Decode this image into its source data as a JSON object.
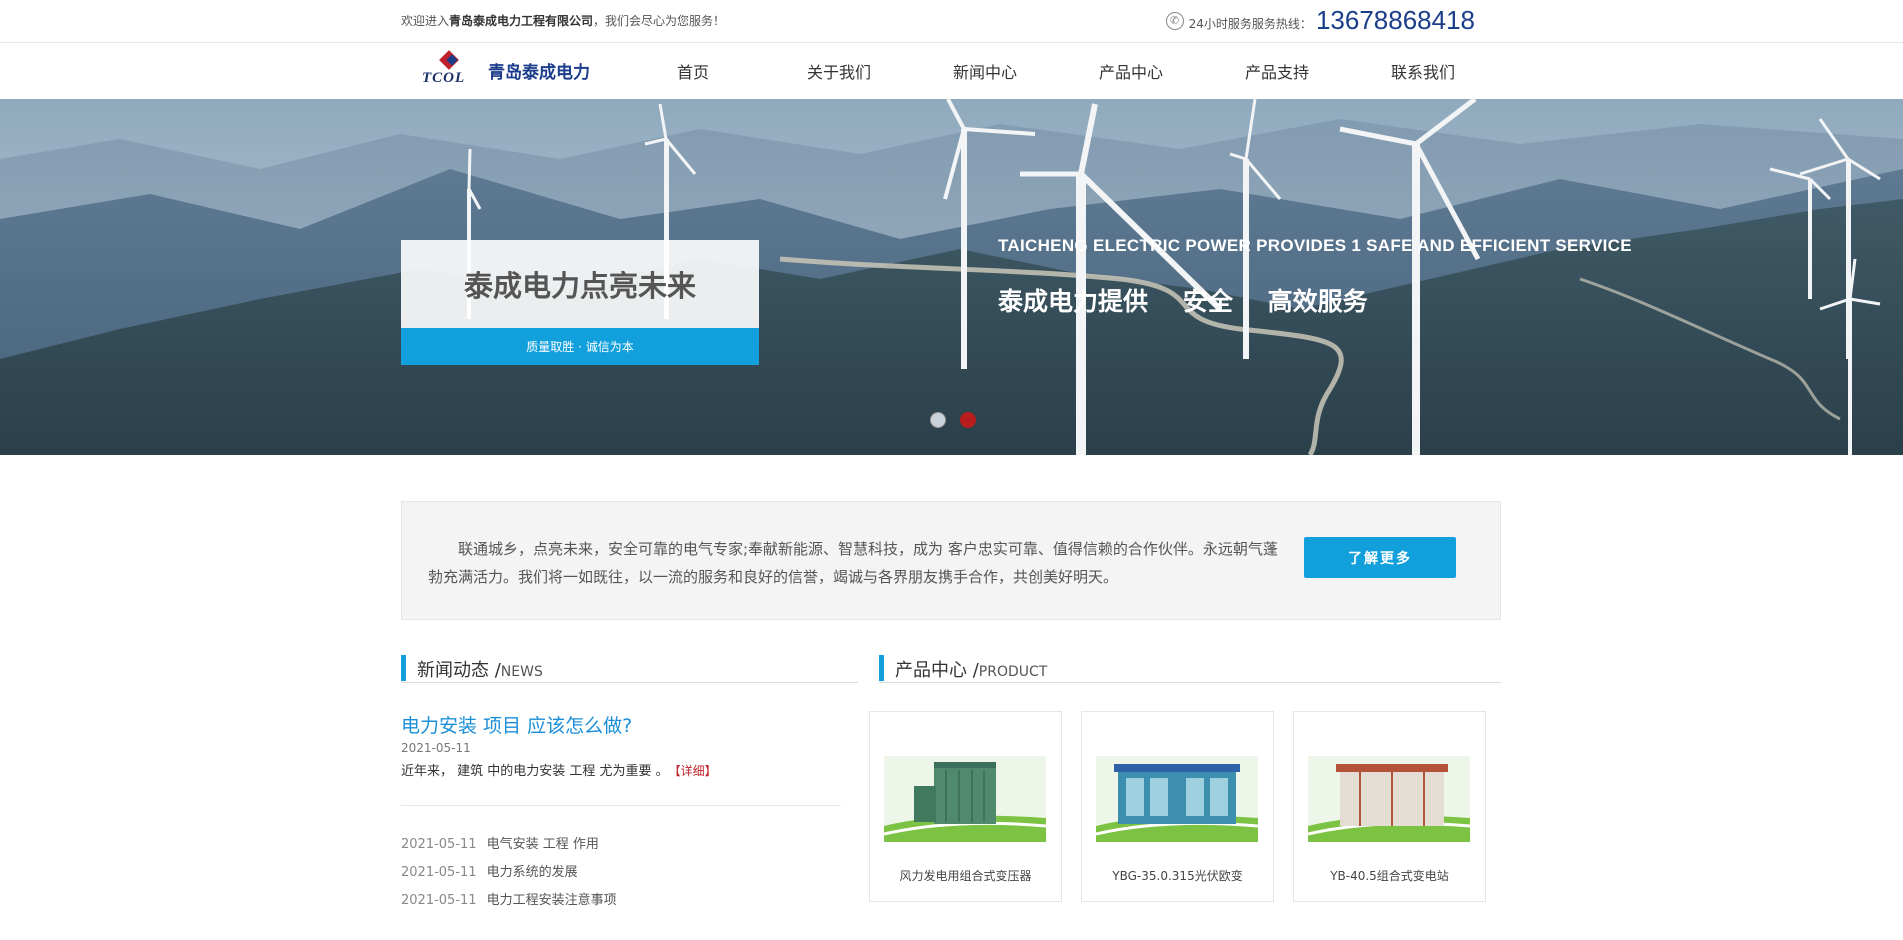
{
  "topbar": {
    "welcome_prefix": "欢迎进入",
    "company": "青岛泰成电力工程有限公司",
    "welcome_suffix": "，我们会尽心为您服务！",
    "hotline_label": "24小时服务服务热线：",
    "hotline_number": "13678868418",
    "phone_icon": "phone-icon"
  },
  "nav": {
    "logo_text": "TCOL",
    "brand": "青岛泰成电力",
    "items": [
      {
        "label": "首页"
      },
      {
        "label": "关于我们"
      },
      {
        "label": "新闻中心"
      },
      {
        "label": "产品中心"
      },
      {
        "label": "产品支持"
      },
      {
        "label": "联系我们"
      }
    ]
  },
  "banner": {
    "slogan": "泰成电力点亮未来",
    "sub_slogan": "质量取胜 · 诚信为本",
    "en_title": "TAICHENG ELECTRIC POWER PROVIDES 1 SAFE AND EFFICIENT SERVICE",
    "cn_title": "泰成电力提供    安全    高效服务",
    "slide_count": 2,
    "active_slide": 2
  },
  "intro": {
    "text": "联通城乡，点亮未来，安全可靠的电气专家;奉献新能源、智慧科技，成为 客户忠实可靠、值得信赖的合作伙伴。永远朝气蓬勃充满活力。我们将一如既往，以一流的服务和良好的信誉，竭诚与各界朋友携手合作，共创美好明天。",
    "button": "了解更多"
  },
  "news": {
    "title_cn": "新闻动态 /",
    "title_en": "NEWS",
    "headline": "电力安装 项目 应该怎么做?",
    "headline_date": "2021-05-11",
    "summary": "近年来， 建筑 中的电力安装 工程 尤为重要 。",
    "detail_label": "【详细】",
    "items": [
      {
        "date": "2021-05-11",
        "title": "电气安装 工程 作用"
      },
      {
        "date": "2021-05-11",
        "title": "电力系统的发展"
      },
      {
        "date": "2021-05-11",
        "title": "电力工程安装注意事项"
      }
    ]
  },
  "products": {
    "title_cn": "产品中心 /",
    "title_en": "PRODUCT",
    "items": [
      {
        "name": "风力发电用组合式变压器",
        "color": "#4f8a6f",
        "roof": "#4f8a6f"
      },
      {
        "name": "YBG-35.0.315光伏欧变",
        "color": "#3d8fb0",
        "roof": "#2d62a8"
      },
      {
        "name": "YB-40.5组合式变电站",
        "color": "#d9d2c8",
        "roof": "#b5533a"
      }
    ]
  },
  "colors": {
    "accent": "#12a0dd",
    "brand": "#1b3d8c",
    "highlight": "#c0232c"
  }
}
